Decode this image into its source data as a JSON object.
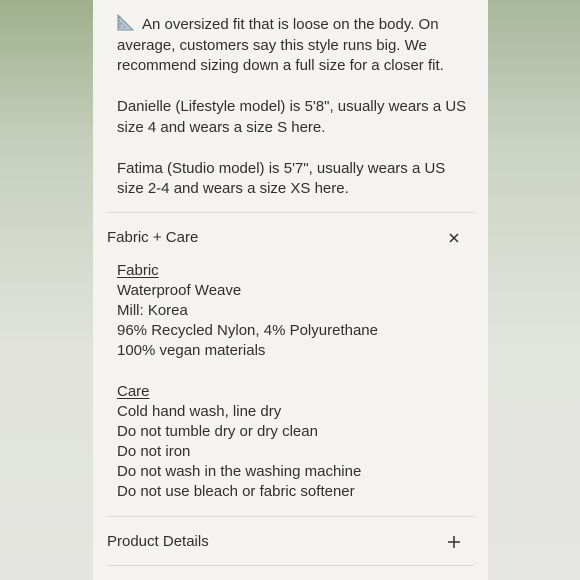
{
  "fit": {
    "icon": "triangular-ruler-icon",
    "description": "An oversized fit that is loose on the body. On average, customers say this style runs big. We recommend sizing down a full size for a closer fit.",
    "model_1": "Danielle (Lifestyle model) is 5'8\", usually wears a US size 4 and wears a size S here.",
    "model_2": "Fatima (Studio model) is 5'7\", usually wears a US size 2-4 and wears a size XS here."
  },
  "accordions": {
    "fabric_care": {
      "title": "Fabric + Care",
      "toggle_icon": "close-icon",
      "fabric_heading": "Fabric",
      "fabric_lines": [
        "Waterproof Weave",
        "Mill: Korea",
        "96% Recycled Nylon, 4% Polyurethane",
        "100% vegan materials"
      ],
      "care_heading": "Care",
      "care_lines": [
        "Cold hand wash, line dry",
        "Do not tumble dry or dry clean",
        "Do not iron",
        "Do not wash in the washing machine",
        "Do not use bleach or fabric softener"
      ]
    },
    "product_details": {
      "title": "Product Details",
      "toggle_icon": "plus-icon"
    }
  }
}
